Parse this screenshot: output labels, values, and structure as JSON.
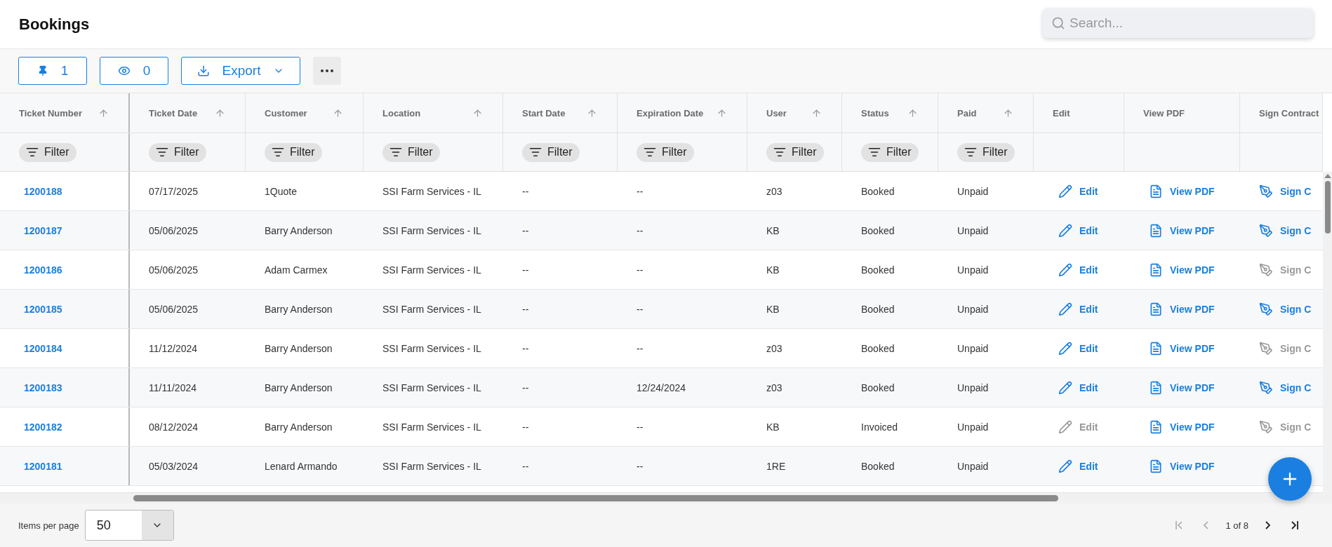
{
  "page": {
    "title": "Bookings"
  },
  "search": {
    "placeholder": "Search..."
  },
  "toolbar": {
    "pinned_count": "1",
    "visible_count": "0",
    "export_label": "Export"
  },
  "table": {
    "columns": [
      {
        "label": "Ticket Number",
        "sortable": true,
        "filter": "Filter"
      },
      {
        "label": "Ticket Date",
        "sortable": true,
        "filter": "Filter"
      },
      {
        "label": "Customer",
        "sortable": true,
        "filter": "Filter"
      },
      {
        "label": "Location",
        "sortable": true,
        "filter": "Filter"
      },
      {
        "label": "Start Date",
        "sortable": true,
        "filter": "Filter"
      },
      {
        "label": "Expiration Date",
        "sortable": true,
        "filter": "Filter"
      },
      {
        "label": "User",
        "sortable": true,
        "filter": "Filter"
      },
      {
        "label": "Status",
        "sortable": true,
        "filter": "Filter"
      },
      {
        "label": "Paid",
        "sortable": true,
        "filter": "Filter"
      },
      {
        "label": "Edit",
        "sortable": false
      },
      {
        "label": "View PDF",
        "sortable": false
      },
      {
        "label": "Sign Contract",
        "sortable": false
      }
    ],
    "rows": [
      {
        "cells": [
          "1200188",
          "07/17/2025",
          "1Quote",
          "SSI Farm Services - IL",
          "--",
          "--",
          "z03",
          "Booked",
          "Unpaid"
        ],
        "edit": {
          "label": "Edit",
          "disabled": false
        },
        "pdf": "View PDF",
        "sign": {
          "label": "Sign C",
          "disabled": false
        }
      },
      {
        "cells": [
          "1200187",
          "05/06/2025",
          "Barry Anderson",
          "SSI Farm Services - IL",
          "--",
          "--",
          "KB",
          "Booked",
          "Unpaid"
        ],
        "edit": {
          "label": "Edit",
          "disabled": false
        },
        "pdf": "View PDF",
        "sign": {
          "label": "Sign C",
          "disabled": false
        }
      },
      {
        "cells": [
          "1200186",
          "05/06/2025",
          "Adam Carmex",
          "SSI Farm Services - IL",
          "--",
          "--",
          "KB",
          "Booked",
          "Unpaid"
        ],
        "edit": {
          "label": "Edit",
          "disabled": false
        },
        "pdf": "View PDF",
        "sign": {
          "label": "Sign C",
          "disabled": true
        }
      },
      {
        "cells": [
          "1200185",
          "05/06/2025",
          "Barry Anderson",
          "SSI Farm Services - IL",
          "--",
          "--",
          "KB",
          "Booked",
          "Unpaid"
        ],
        "edit": {
          "label": "Edit",
          "disabled": false
        },
        "pdf": "View PDF",
        "sign": {
          "label": "Sign C",
          "disabled": false
        }
      },
      {
        "cells": [
          "1200184",
          "11/12/2024",
          "Barry Anderson",
          "SSI Farm Services - IL",
          "--",
          "--",
          "z03",
          "Booked",
          "Unpaid"
        ],
        "edit": {
          "label": "Edit",
          "disabled": false
        },
        "pdf": "View PDF",
        "sign": {
          "label": "Sign C",
          "disabled": true
        }
      },
      {
        "cells": [
          "1200183",
          "11/11/2024",
          "Barry Anderson",
          "SSI Farm Services - IL",
          "--",
          "12/24/2024",
          "z03",
          "Booked",
          "Unpaid"
        ],
        "edit": {
          "label": "Edit",
          "disabled": false
        },
        "pdf": "View PDF",
        "sign": {
          "label": "Sign C",
          "disabled": false
        }
      },
      {
        "cells": [
          "1200182",
          "08/12/2024",
          "Barry Anderson",
          "SSI Farm Services - IL",
          "--",
          "--",
          "KB",
          "Invoiced",
          "Unpaid"
        ],
        "edit": {
          "label": "Edit",
          "disabled": true
        },
        "pdf": "View PDF",
        "sign": {
          "label": "Sign C",
          "disabled": true
        }
      },
      {
        "cells": [
          "1200181",
          "05/03/2024",
          "Lenard Armando",
          "SSI Farm Services - IL",
          "--",
          "--",
          "1RE",
          "Booked",
          "Unpaid"
        ],
        "edit": {
          "label": "Edit",
          "disabled": false
        },
        "pdf": "View PDF"
      }
    ]
  },
  "footer": {
    "items_per_page_label": "Items per page",
    "items_per_page": "50",
    "page_info": "1 of 8"
  }
}
